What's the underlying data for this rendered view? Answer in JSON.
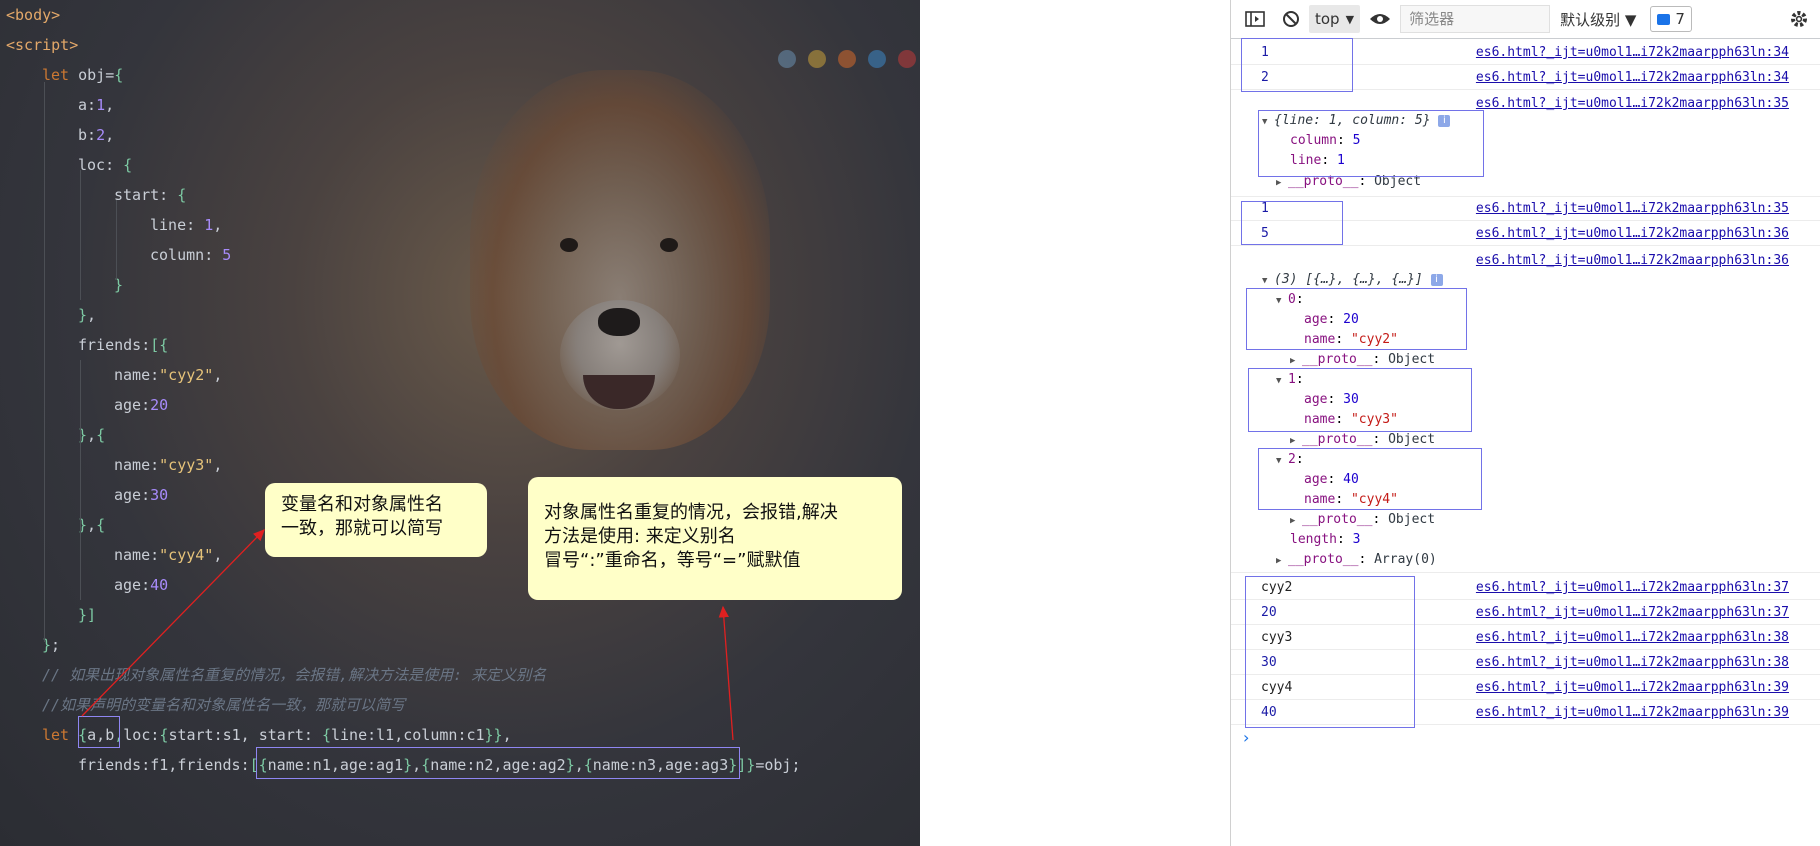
{
  "editor": {
    "lines": [
      {
        "parts": [
          [
            "tag",
            "<body>"
          ]
        ]
      },
      {
        "parts": [
          [
            "tag",
            "<script>"
          ]
        ]
      },
      {
        "parts": [
          [
            "kw",
            "let "
          ],
          [
            "punc",
            "obj"
          ],
          [
            "punc",
            "="
          ],
          [
            "brace",
            "{"
          ]
        ]
      },
      {
        "parts": [
          [
            "punc",
            "a"
          ],
          [
            "punc",
            ":"
          ],
          [
            "num",
            "1"
          ],
          [
            "punc",
            ","
          ]
        ]
      },
      {
        "parts": [
          [
            "punc",
            "b"
          ],
          [
            "punc",
            ":"
          ],
          [
            "num",
            "2"
          ],
          [
            "punc",
            ","
          ]
        ]
      },
      {
        "parts": [
          [
            "punc",
            "loc"
          ],
          [
            "punc",
            ": "
          ],
          [
            "brace",
            "{"
          ]
        ]
      },
      {
        "parts": [
          [
            "punc",
            "start"
          ],
          [
            "punc",
            ": "
          ],
          [
            "brace",
            "{"
          ]
        ]
      },
      {
        "parts": [
          [
            "punc",
            "line"
          ],
          [
            "punc",
            ": "
          ],
          [
            "num",
            "1"
          ],
          [
            "punc",
            ","
          ]
        ]
      },
      {
        "parts": [
          [
            "punc",
            "column"
          ],
          [
            "punc",
            ": "
          ],
          [
            "num",
            "5"
          ]
        ]
      },
      {
        "parts": [
          [
            "brace",
            "}"
          ]
        ]
      },
      {
        "parts": [
          [
            "brace",
            "}"
          ],
          [
            "punc",
            ","
          ]
        ]
      },
      {
        "parts": [
          [
            "punc",
            "friends"
          ],
          [
            "punc",
            ":"
          ],
          [
            "brace",
            "[{"
          ]
        ]
      },
      {
        "parts": [
          [
            "punc",
            "name"
          ],
          [
            "punc",
            ":"
          ],
          [
            "str",
            "\"cyy2\""
          ],
          [
            "punc",
            ","
          ]
        ]
      },
      {
        "parts": [
          [
            "punc",
            "age"
          ],
          [
            "punc",
            ":"
          ],
          [
            "num",
            "20"
          ]
        ]
      },
      {
        "parts": [
          [
            "brace",
            "}"
          ],
          [
            "punc",
            ","
          ],
          [
            "brace",
            "{"
          ]
        ]
      },
      {
        "parts": [
          [
            "punc",
            "name"
          ],
          [
            "punc",
            ":"
          ],
          [
            "str",
            "\"cyy3\""
          ],
          [
            "punc",
            ","
          ]
        ]
      },
      {
        "parts": [
          [
            "punc",
            "age"
          ],
          [
            "punc",
            ":"
          ],
          [
            "num",
            "30"
          ]
        ]
      },
      {
        "parts": [
          [
            "brace",
            "}"
          ],
          [
            "punc",
            ","
          ],
          [
            "brace",
            "{"
          ]
        ]
      },
      {
        "parts": [
          [
            "punc",
            "name"
          ],
          [
            "punc",
            ":"
          ],
          [
            "str",
            "\"cyy4\""
          ],
          [
            "punc",
            ","
          ]
        ]
      },
      {
        "parts": [
          [
            "punc",
            "age"
          ],
          [
            "punc",
            ":"
          ],
          [
            "num",
            "40"
          ]
        ]
      },
      {
        "parts": [
          [
            "brace",
            "}]"
          ]
        ]
      },
      {
        "parts": [
          [
            "brace",
            "}"
          ],
          [
            "punc",
            ";"
          ]
        ]
      },
      {
        "parts": [
          [
            "cmt",
            "// 如果出现对象属性名重复的情况，会报错,解决方法是使用: 来定义别名"
          ]
        ]
      },
      {
        "parts": [
          [
            "cmt",
            "//如果声明的变量名和对象属性名一致，那就可以简写"
          ]
        ]
      },
      {
        "parts": [
          [
            "kw",
            "let "
          ],
          [
            "brace",
            "{"
          ],
          [
            "punc",
            "a,b"
          ],
          [
            "brace",
            ","
          ],
          [
            "punc",
            "loc"
          ],
          [
            "punc",
            ":"
          ],
          [
            "brace",
            "{"
          ],
          [
            "punc",
            "start"
          ],
          [
            "punc",
            ":"
          ],
          [
            "punc",
            "s1, start: "
          ],
          [
            "brace",
            "{"
          ],
          [
            "punc",
            "line"
          ],
          [
            "punc",
            ":"
          ],
          [
            "punc",
            "l1,column"
          ],
          [
            "punc",
            ":"
          ],
          [
            "punc",
            "c1"
          ],
          [
            "brace",
            "}}"
          ],
          [
            "punc",
            ","
          ]
        ]
      },
      {
        "parts": [
          [
            "punc",
            "friends"
          ],
          [
            "punc",
            ":"
          ],
          [
            "punc",
            "f1,friends"
          ],
          [
            "punc",
            ":"
          ],
          [
            "brace",
            "["
          ],
          [
            "brace",
            "{"
          ],
          [
            "punc",
            "name:n1,age:ag1"
          ],
          [
            "brace",
            "}"
          ],
          [
            "punc",
            ","
          ],
          [
            "brace",
            "{"
          ],
          [
            "punc",
            "name:n2,age:ag2"
          ],
          [
            "brace",
            "}"
          ],
          [
            "punc",
            ","
          ],
          [
            "brace",
            "{"
          ],
          [
            "punc",
            "name:n3,age:ag3"
          ],
          [
            "brace",
            "}"
          ],
          [
            "brace",
            "]}"
          ],
          [
            "punc",
            "=obj;"
          ]
        ]
      }
    ]
  },
  "callouts": {
    "left": [
      "变量名和对象属性名",
      "一致，那就可以简写"
    ],
    "right": [
      "对象属性名重复的情况，会报错,解决",
      "方法是使用: 来定义别名",
      "冒号“:”重命名，等号“=”赋默值"
    ]
  },
  "devtools": {
    "toolbar": {
      "context": "top",
      "filter_placeholder": "筛选器",
      "levels": "默认级别 ▼",
      "issues_count": "7"
    },
    "logs": [
      {
        "value": "1",
        "source": "es6.html?_ijt=u0mol1…i72k2maarpph63l n:34"
      },
      {
        "value": "2",
        "source": "es6.html?_ijt=u0mol1…i72k2maarpph63l n:34"
      }
    ],
    "src_35": "es6.html?_ijt=u0mol1…i72k2maarpph63ln:35",
    "src_34": "es6.html?_ijt=u0mol1…i72k2maarpph63ln:34",
    "src_36": "es6.html?_ijt=u0mol1…i72k2maarpph63ln:36",
    "src_37": "es6.html?_ijt=u0mol1…i72k2maarpph63ln:37",
    "src_38": "es6.html?_ijt=u0mol1…i72k2maarpph63ln:38",
    "src_39": "es6.html?_ijt=u0mol1…i72k2maarpph63ln:39",
    "obj_summary": "{line: 1, column: 5}",
    "obj_props": [
      [
        "column",
        "5"
      ],
      [
        "line",
        "1"
      ]
    ],
    "proto_label": "__proto__",
    "proto_value": "Object",
    "proto_array": "Array(0)",
    "vals_35_36": [
      "1",
      "5"
    ],
    "arr_summary": "(3) [{…}, {…}, {…}]",
    "arr_items": [
      {
        "idx": "0",
        "age": "20",
        "name": "\"cyy2\""
      },
      {
        "idx": "1",
        "age": "30",
        "name": "\"cyy3\""
      },
      {
        "idx": "2",
        "age": "40",
        "name": "\"cyy4\""
      }
    ],
    "length_label": "length",
    "length_value": "3",
    "tail_logs": [
      {
        "value": "cyy2",
        "type": "str",
        "line": "37"
      },
      {
        "value": "20",
        "type": "num",
        "line": "37"
      },
      {
        "value": "cyy3",
        "type": "str",
        "line": "38"
      },
      {
        "value": "30",
        "type": "num",
        "line": "38"
      },
      {
        "value": "cyy4",
        "type": "str",
        "line": "39"
      },
      {
        "value": "40",
        "type": "num",
        "line": "39"
      }
    ],
    "prompt": "›"
  }
}
